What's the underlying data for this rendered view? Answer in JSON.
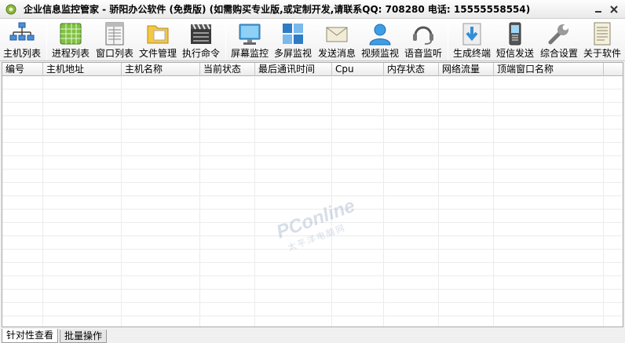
{
  "window": {
    "title": "企业信息监控管家 - 骄阳办公软件 (免费版) (如需购买专业版,或定制开发,请联系QQ: 708280 电话: 15555558554)"
  },
  "toolbar": {
    "items": [
      {
        "label": "主机列表",
        "icon": "host-list-icon"
      },
      {
        "label": "进程列表",
        "icon": "process-list-icon"
      },
      {
        "label": "窗口列表",
        "icon": "window-list-icon"
      },
      {
        "label": "文件管理",
        "icon": "folder-icon"
      },
      {
        "label": "执行命令",
        "icon": "command-icon"
      },
      {
        "label": "屏幕监控",
        "icon": "monitor-icon"
      },
      {
        "label": "多屏监视",
        "icon": "multi-screen-icon"
      },
      {
        "label": "发送消息",
        "icon": "envelope-icon"
      },
      {
        "label": "视频监视",
        "icon": "user-camera-icon"
      },
      {
        "label": "语音监听",
        "icon": "headset-icon"
      },
      {
        "label": "生成终端",
        "icon": "download-icon"
      },
      {
        "label": "短信发送",
        "icon": "phone-icon"
      },
      {
        "label": "综合设置",
        "icon": "wrench-icon"
      },
      {
        "label": "关于软件",
        "icon": "document-icon"
      }
    ]
  },
  "table": {
    "columns": [
      "编号",
      "主机地址",
      "主机名称",
      "当前状态",
      "最后通讯时间",
      "Cpu",
      "内存状态",
      "网络流量",
      "顶端窗口名称"
    ],
    "rows": []
  },
  "watermark": {
    "main": "PConline",
    "sub": "太平洋电脑网"
  },
  "tabs": [
    "针对性查看",
    "批量操作"
  ],
  "colors": {
    "accent": "#3a8fd6",
    "toolbar_bg": "#f7f7f7"
  }
}
